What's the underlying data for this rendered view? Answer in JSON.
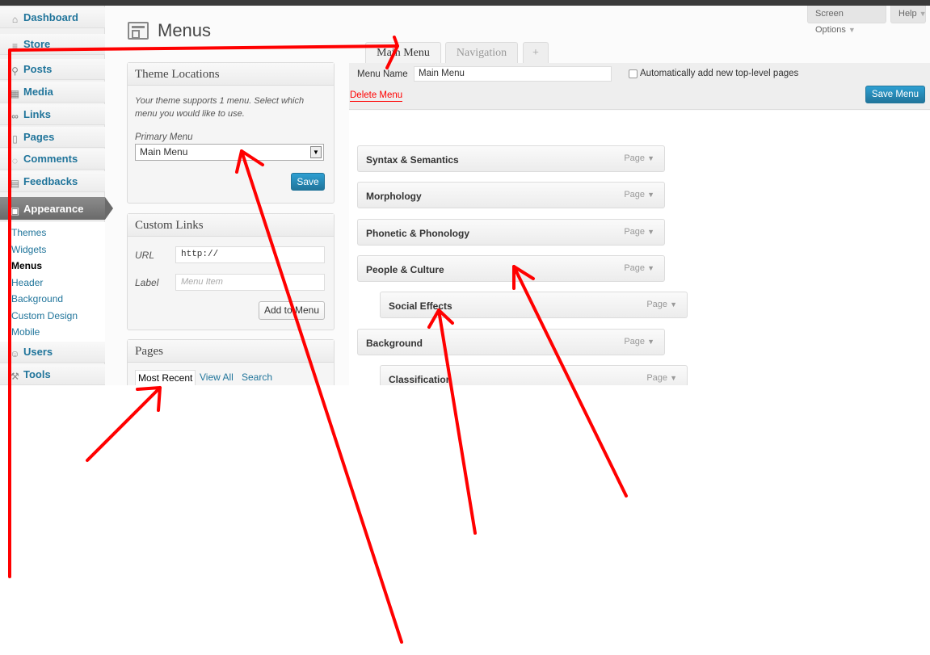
{
  "sidebar": {
    "items": [
      {
        "label": "Dashboard",
        "icon": "house-icon"
      },
      {
        "label": "Store",
        "icon": "cart-icon"
      },
      {
        "label": "Posts",
        "icon": "pushpin-icon"
      },
      {
        "label": "Media",
        "icon": "media-icon"
      },
      {
        "label": "Links",
        "icon": "link-icon"
      },
      {
        "label": "Pages",
        "icon": "page-icon"
      },
      {
        "label": "Comments",
        "icon": "speech-bubble-icon"
      },
      {
        "label": "Feedbacks",
        "icon": "feedback-icon"
      },
      {
        "label": "Appearance",
        "icon": "appearance-icon"
      },
      {
        "label": "Users",
        "icon": "users-icon"
      },
      {
        "label": "Tools",
        "icon": "tools-icon"
      }
    ],
    "submenu": [
      "Themes",
      "Widgets",
      "Menus",
      "Header",
      "Background",
      "Custom Design",
      "Mobile"
    ]
  },
  "header": {
    "title": "Menus",
    "screen_options": "Screen Options",
    "help": "Help"
  },
  "theme_locations": {
    "title": "Theme Locations",
    "note_line1": "Your theme supports 1 menu. Select which",
    "note_line2": "menu you would like to use.",
    "primary_label": "Primary Menu",
    "selected": "Main Menu",
    "save": "Save"
  },
  "custom_links": {
    "title": "Custom Links",
    "url_label": "URL",
    "url_value": "http://",
    "label_label": "Label",
    "label_placeholder": "Menu Item",
    "add_button": "Add to Menu"
  },
  "pages_panel": {
    "title": "Pages",
    "tabs": [
      "Most Recent",
      "View All",
      "Search"
    ]
  },
  "menu_tabs": [
    "Main Menu",
    "Navigation",
    "+"
  ],
  "menu_editor": {
    "name_label": "Menu Name",
    "name_value": "Main Menu",
    "auto_add_label": "Automatically add new top-level pages",
    "delete_label": "Delete Menu",
    "save_label": "Save Menu",
    "items": [
      {
        "title": "Syntax & Semantics",
        "type": "Page",
        "depth": 0
      },
      {
        "title": "Morphology",
        "type": "Page",
        "depth": 0
      },
      {
        "title": "Phonetic & Phonology",
        "type": "Page",
        "depth": 0
      },
      {
        "title": "People & Culture",
        "type": "Page",
        "depth": 0
      },
      {
        "title": "Social Effects",
        "type": "Page",
        "depth": 1
      },
      {
        "title": "Background",
        "type": "Page",
        "depth": 0
      },
      {
        "title": "Classification",
        "type": "Page",
        "depth": 1
      }
    ]
  },
  "colors": {
    "link": "#21759b",
    "primary_button": "#21759b",
    "delete_link": "#ff0000",
    "annotation": "#ff0000",
    "active_nav": "#777777"
  }
}
